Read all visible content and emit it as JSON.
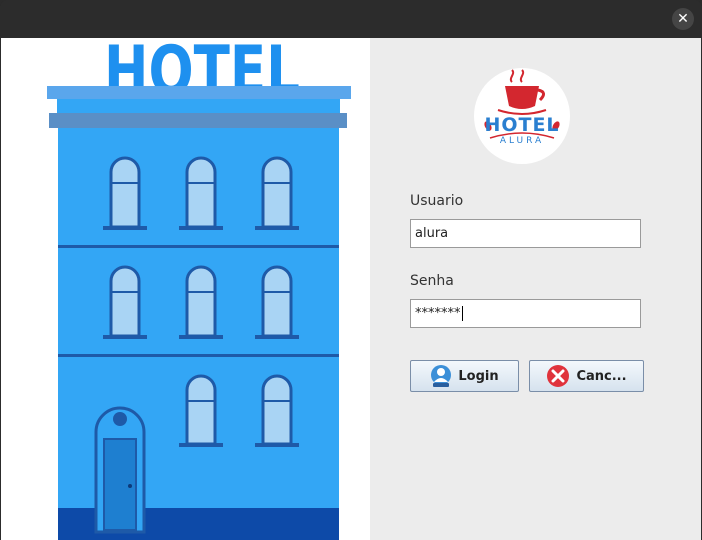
{
  "window": {
    "close_glyph": "✕"
  },
  "hero": {
    "sign_text": "HOTEL"
  },
  "logo": {
    "brand": "HOTEL",
    "sub": "ALURA"
  },
  "form": {
    "user_label": "Usuario",
    "user_value": "alura",
    "pass_label": "Senha",
    "pass_value": "*******"
  },
  "buttons": {
    "login_label": "Login",
    "cancel_label": "Canc..."
  },
  "colors": {
    "building": "#33a6f5",
    "building_dark": "#1e5aa8",
    "sign": "#1e90ef",
    "logo_red": "#d3272f",
    "logo_blue": "#2a7fd0"
  }
}
